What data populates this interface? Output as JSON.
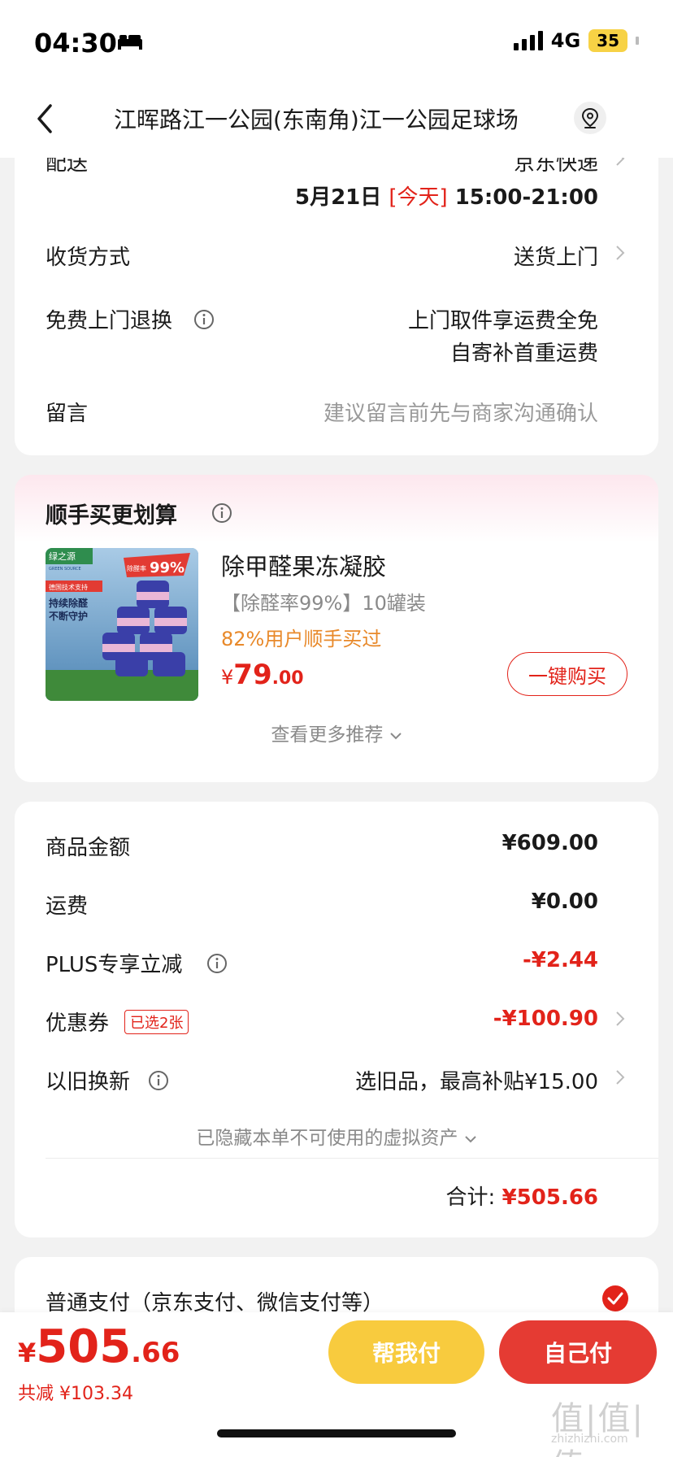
{
  "status": {
    "time": "04:30",
    "network": "4G",
    "battery": "35"
  },
  "nav": {
    "title": "江晖路江一公园(东南角)江一公园足球场"
  },
  "delivery": {
    "partial_label": "配送",
    "partial_value": "京东快递",
    "date": "5月21日",
    "today": "[今天]",
    "time": "15:00-21:00",
    "receive_label": "收货方式",
    "receive_value": "送货上门",
    "return_label": "免费上门退换",
    "return_line1": "上门取件享运费全免",
    "return_line2": "自寄补首重运费",
    "note_label": "留言",
    "note_placeholder": "建议留言前先与商家沟通确认"
  },
  "recommend": {
    "title": "顺手买更划算",
    "product_name": "除甲醛果冻凝胶",
    "product_sub": "【除醛率99%】10罐装",
    "product_stat": "82%用户顺手买过",
    "price_symbol": "¥",
    "price_int": "79",
    "price_dec": ".00",
    "buy_label": "一键购买",
    "more_label": "查看更多推荐",
    "image_texts": {
      "brand": "绿之源",
      "brand_en": "GREEN SOURCE",
      "tag": "德国技术支持",
      "rate": "99%",
      "rate_label": "除醛率",
      "slogan1": "持续除醛",
      "slogan2": "不断守护"
    }
  },
  "summary": {
    "goods_label": "商品金额",
    "goods_value": "¥609.00",
    "ship_label": "运费",
    "ship_value": "¥0.00",
    "plus_label": "PLUS专享立减",
    "plus_value": "-¥2.44",
    "coupon_label": "优惠券",
    "coupon_badge": "已选2张",
    "coupon_value": "-¥100.90",
    "tradein_label": "以旧换新",
    "tradein_value": "选旧品，最高补贴¥15.00",
    "hidden_assets": "已隐藏本单不可使用的虚拟资产",
    "total_label": "合计:",
    "total_value": "¥505.66"
  },
  "payment": {
    "label": "普通支付（京东支付、微信支付等）"
  },
  "bottom": {
    "symbol": "¥",
    "total_int": "505",
    "total_dec": ".66",
    "saved": "共减 ¥103.34",
    "help_label": "帮我付",
    "self_label": "自己付"
  },
  "watermark": {
    "main": "值|值|值",
    "sub": "zhizhizhi.com"
  },
  "colors": {
    "accent_red": "#e2231a",
    "help_yellow": "#f8cb3e",
    "self_red": "#e53b33",
    "stat_orange": "#e8892a"
  }
}
